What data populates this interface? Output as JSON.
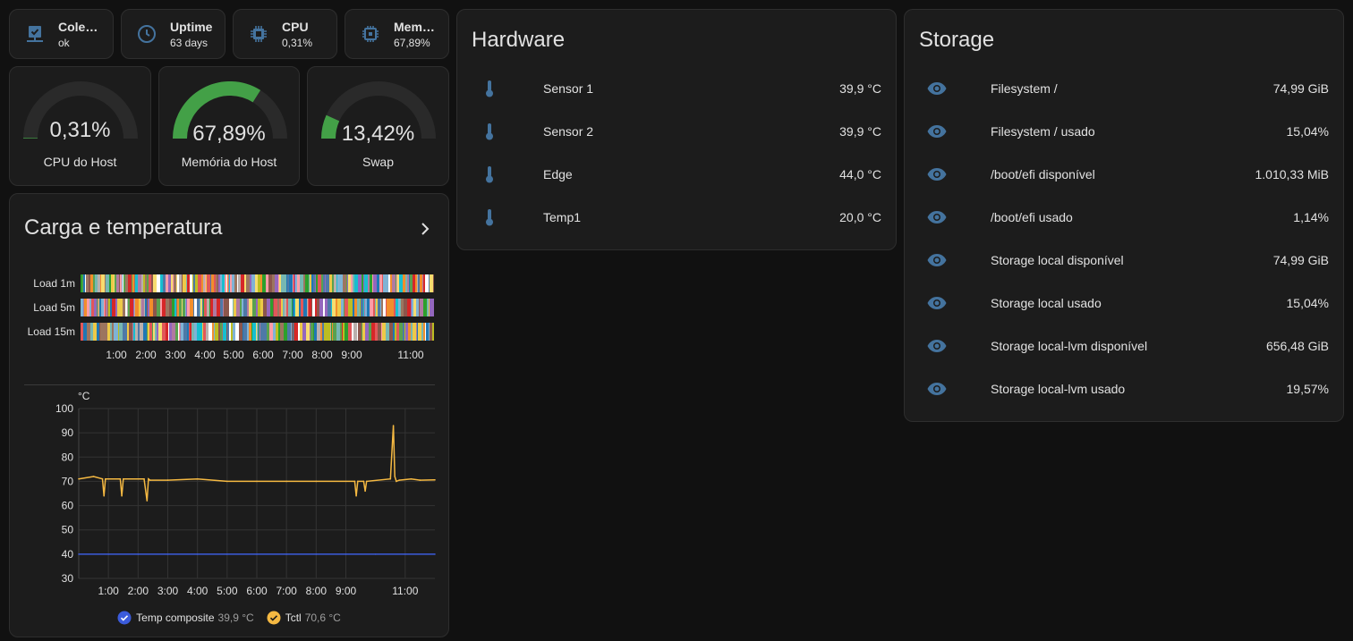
{
  "colors": {
    "background": "#111111",
    "card": "#1c1c1c",
    "icon": "#44739e",
    "gauge_green": "#43a047",
    "gauge_track": "#2a2a2a",
    "temp_composite": "#3b5bdb",
    "tctl": "#f5b942"
  },
  "tiles": [
    {
      "name": "Coleção",
      "state": "ok",
      "icon": "server-network-icon"
    },
    {
      "name": "Uptime",
      "state": "63 days",
      "icon": "clock-icon"
    },
    {
      "name": "CPU",
      "state": "0,31%",
      "icon": "cpu-chip-icon"
    },
    {
      "name": "Memória",
      "state": "67,89%",
      "icon": "memory-chip-icon"
    }
  ],
  "gauges": [
    {
      "label": "CPU do Host",
      "value_text": "0,31%",
      "value": 0.31
    },
    {
      "label": "Memória do Host",
      "value_text": "67,89%",
      "value": 67.89
    },
    {
      "label": "Swap",
      "value_text": "13,42%",
      "value": 13.42
    }
  ],
  "load_card": {
    "title": "Carga e temperatura",
    "timeline_rows": [
      "Load 1m",
      "Load 5m",
      "Load 15m"
    ],
    "time_ticks": [
      "1:00",
      "2:00",
      "3:00",
      "4:00",
      "5:00",
      "6:00",
      "7:00",
      "8:00",
      "9:00",
      "11:00"
    ]
  },
  "chart_data": {
    "type": "line",
    "ylabel": "°C",
    "ylim": [
      30,
      100
    ],
    "yticks": [
      100,
      90,
      80,
      70,
      60,
      50,
      40,
      30
    ],
    "x_ticks": [
      "1:00",
      "2:00",
      "3:00",
      "4:00",
      "5:00",
      "6:00",
      "7:00",
      "8:00",
      "9:00",
      "11:00"
    ],
    "grid": true,
    "legend_position": "bottom",
    "series": [
      {
        "name": "Temp composite",
        "legend_value": "39,9 °C",
        "color": "#3b5bdb",
        "x": [
          0,
          1,
          2,
          3,
          4,
          5,
          6,
          7,
          8,
          9,
          10,
          11,
          12
        ],
        "y": [
          40,
          40,
          40,
          40,
          40,
          40,
          40,
          40,
          40,
          40,
          40,
          40,
          40
        ]
      },
      {
        "name": "Tctl",
        "legend_value": "70,6 °C",
        "color": "#f5b942",
        "x": [
          0,
          0.5,
          0.8,
          0.85,
          0.9,
          1.4,
          1.45,
          1.5,
          2.2,
          2.3,
          2.35,
          2.4,
          3,
          4,
          5,
          6,
          7,
          8,
          9.3,
          9.35,
          9.4,
          9.6,
          9.65,
          9.7,
          10.5,
          10.6,
          10.65,
          10.7,
          10.8,
          11.2,
          11.5,
          12
        ],
        "y": [
          71,
          72,
          71,
          64,
          71,
          71,
          64,
          71,
          71,
          62,
          71,
          70.5,
          70.5,
          71,
          70,
          70,
          70,
          70,
          70,
          64,
          70,
          70,
          66,
          70,
          71,
          93,
          72,
          70,
          70.5,
          71,
          70.5,
          70.6
        ]
      }
    ]
  },
  "hardware": {
    "title": "Hardware",
    "rows": [
      {
        "name": "Sensor 1",
        "value": "39,9 °C"
      },
      {
        "name": "Sensor 2",
        "value": "39,9 °C"
      },
      {
        "name": "Edge",
        "value": "44,0 °C"
      },
      {
        "name": "Temp1",
        "value": "20,0 °C"
      }
    ]
  },
  "storage": {
    "title": "Storage",
    "rows": [
      {
        "name": "Filesystem /",
        "value": "74,99 GiB"
      },
      {
        "name": "Filesystem / usado",
        "value": "15,04%"
      },
      {
        "name": "/boot/efi disponível",
        "value": "1.010,33 MiB"
      },
      {
        "name": "/boot/efi usado",
        "value": "1,14%"
      },
      {
        "name": "Storage local disponível",
        "value": "74,99 GiB"
      },
      {
        "name": "Storage local usado",
        "value": "15,04%"
      },
      {
        "name": "Storage local-lvm disponível",
        "value": "656,48 GiB"
      },
      {
        "name": "Storage local-lvm usado",
        "value": "19,57%"
      }
    ]
  }
}
